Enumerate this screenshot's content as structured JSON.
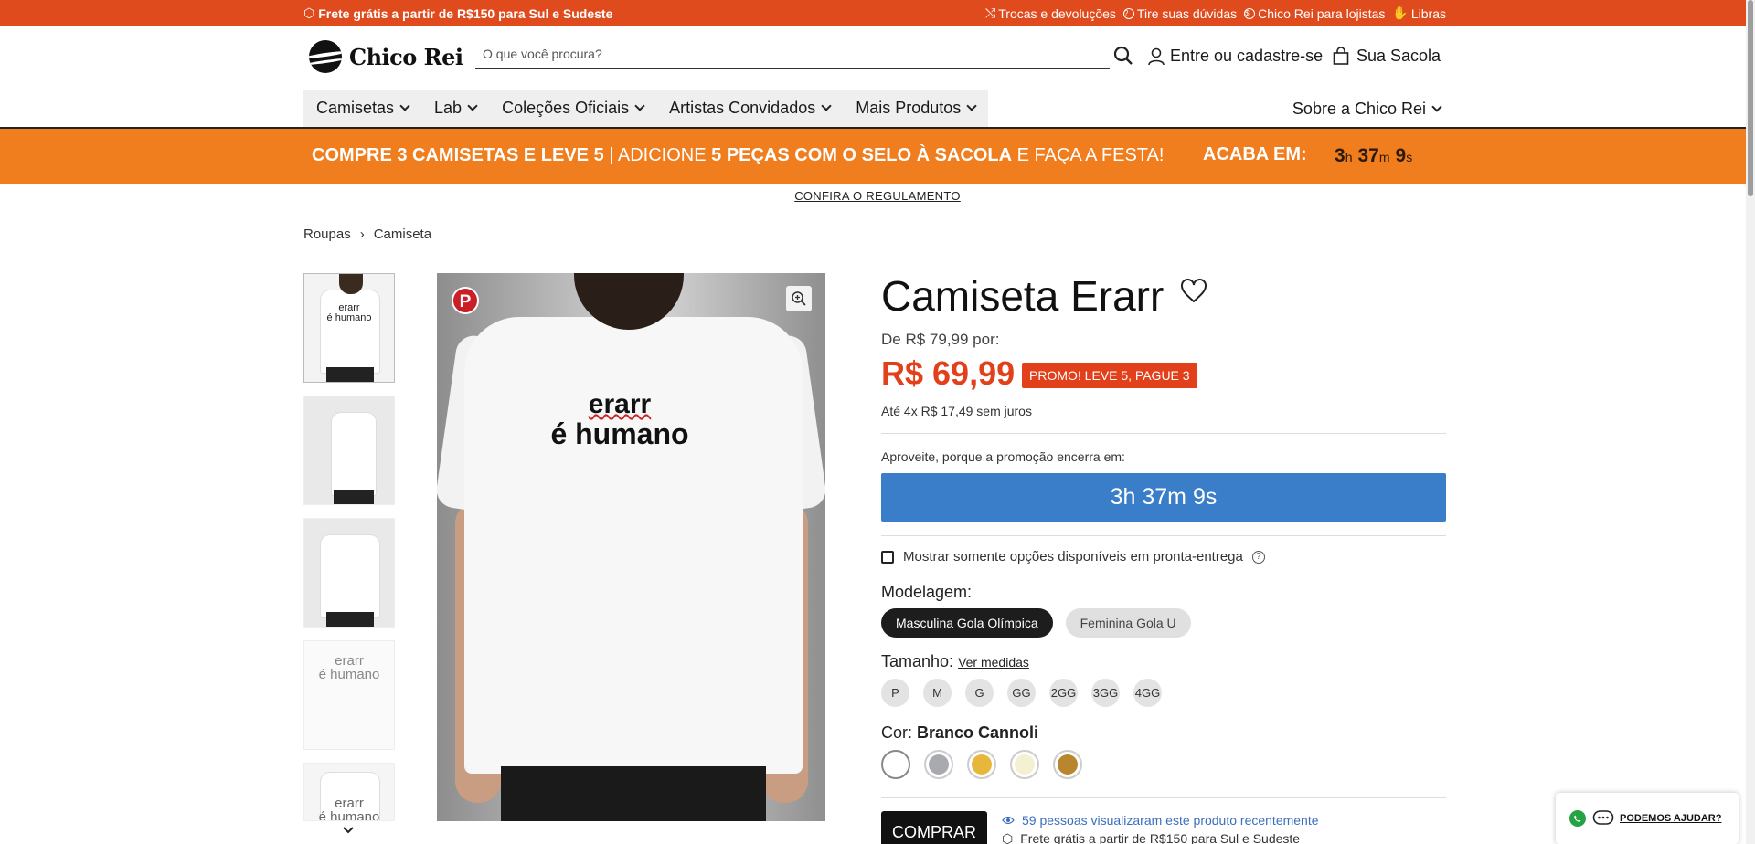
{
  "topbar": {
    "free_shipping": "Frete grátis a partir de R$150 para Sul e Sudeste",
    "links": [
      "Trocas e devoluções",
      "Tire suas dúvidas",
      "Chico Rei para lojistas",
      "Libras"
    ]
  },
  "header": {
    "logo_text": "Chico Rei",
    "search_placeholder": "O que você procura?",
    "login": "Entre ou cadastre-se",
    "bag": "Sua Sacola"
  },
  "nav": {
    "items": [
      "Camisetas",
      "Lab",
      "Coleções Oficiais",
      "Artistas Convidados",
      "Mais Produtos"
    ],
    "about": "Sobre a Chico Rei"
  },
  "promo": {
    "bold1": "COMPRE 3 CAMISETAS E LEVE 5",
    "sep": " | ADICIONE ",
    "bold2": "5 PEÇAS COM O SELO À SACOLA",
    "rest": " E FAÇA A FESTA!",
    "ends_label": "ACABA EM:",
    "hours": "3",
    "minutes": "37",
    "seconds": "9",
    "h_unit": "h",
    "m_unit": "m",
    "s_unit": "s",
    "rules_link": "CONFIRA O REGULAMENTO"
  },
  "breadcrumb": {
    "items": [
      "Roupas",
      "Camiseta"
    ],
    "separator": "›"
  },
  "gallery": {
    "thumb_prints": [
      "erarr",
      "é humano"
    ],
    "print_line1": "erarr",
    "print_line2": "é humano",
    "pin_letter": "P"
  },
  "product": {
    "title": "Camiseta Erarr",
    "old_price": "De R$ 79,99 por:",
    "price": "R$ 69,99",
    "badge": "PROMO! LEVE 5, PAGUE 3",
    "installments": "Até 4x R$ 17,49 sem juros",
    "promo_ends_label": "Aproveite, porque a promoção encerra em:",
    "countdown": "3h 37m 9s",
    "availability_toggle": "Mostrar somente opções disponíveis em pronta-entrega",
    "model_label": "Modelagem:",
    "models": [
      {
        "label": "Masculina Gola Olímpica",
        "selected": true
      },
      {
        "label": "Feminina Gola U",
        "selected": false
      }
    ],
    "size_label": "Tamanho:",
    "size_guide": "Ver medidas",
    "sizes": [
      "P",
      "M",
      "G",
      "GG",
      "2GG",
      "3GG",
      "4GG"
    ],
    "color_label": "Cor:",
    "color_name": "Branco Cannoli",
    "colors": [
      "#ffffff",
      "#a9aaaf",
      "#e9b63c",
      "#f3f1d2",
      "#b7862f"
    ],
    "buy_button": "COMPRAR",
    "views_text": "59 pessoas visualizaram este produto recentemente",
    "shipping_text": "Frete grátis a partir de R$150 para Sul e Sudeste"
  },
  "help_widget": {
    "label": "PODEMOS AJUDAR?"
  },
  "colors": {
    "topbar": "#e04b1e",
    "promo": "#f07d1e",
    "price": "#e2401b",
    "countdown_bar": "#3a7dc9"
  }
}
